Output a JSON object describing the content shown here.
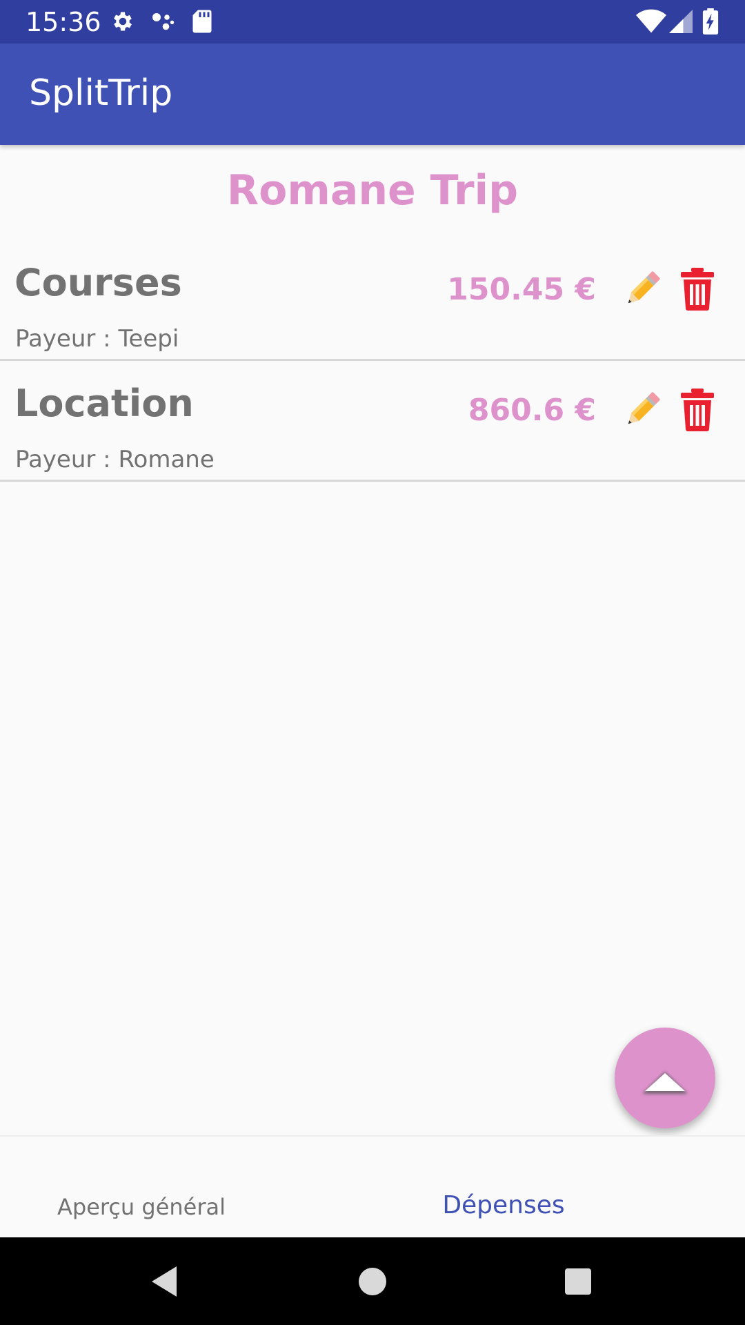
{
  "status_bar": {
    "time": "15:36",
    "icons": [
      "gear-icon",
      "assistant-dots-icon",
      "sd-card-icon",
      "wifi-icon",
      "signal-icon",
      "battery-charging-icon"
    ]
  },
  "app_bar": {
    "title": "SplitTrip"
  },
  "trip": {
    "title": "Romane Trip"
  },
  "expenses": [
    {
      "name": "Courses",
      "payer": "Payeur : Teepi",
      "amount": "150.45 €"
    },
    {
      "name": "Location",
      "payer": "Payeur : Romane",
      "amount": "860.6 €"
    }
  ],
  "tabs": {
    "overview_label": "Aperçu général",
    "expenses_label": "Dépenses",
    "selected": "Dépenses"
  },
  "colors": {
    "status_bar": "#303f9f",
    "primary": "#3f51b5",
    "accent": "#de92cc",
    "text_gray": "#727272",
    "delete_red": "#e8202f"
  },
  "icons": {
    "edit": "pencil-icon",
    "delete": "trash-icon",
    "fab": "chevron-up-icon"
  }
}
